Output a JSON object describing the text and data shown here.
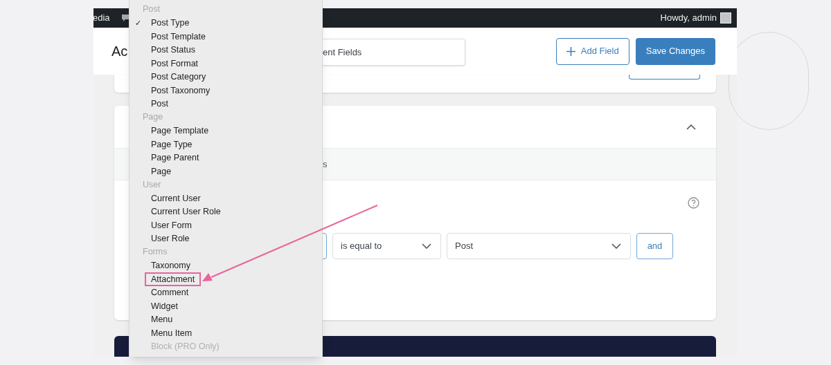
{
  "admin_bar": {
    "left_text": "edia",
    "greeting": "Howdy, admin"
  },
  "header": {
    "title": "Ac",
    "title_field_value": "ent Fields",
    "buttons": [
      {
        "label": "Add Field",
        "kind": "outline"
      },
      {
        "label": "Save Changes",
        "kind": "primary"
      }
    ]
  },
  "rules_card": {
    "band_text": "s",
    "condition": {
      "operator": "is equal to",
      "value": "Post",
      "and_button": "and"
    }
  },
  "dropdown": {
    "check_mark": "✓",
    "groups": [
      {
        "label": "Post",
        "items": [
          {
            "label": "Post Type",
            "checked": true,
            "disabled": false,
            "annotated": false
          },
          {
            "label": "Post Template",
            "checked": false,
            "disabled": false,
            "annotated": false
          },
          {
            "label": "Post Status",
            "checked": false,
            "disabled": false,
            "annotated": false
          },
          {
            "label": "Post Format",
            "checked": false,
            "disabled": false,
            "annotated": false
          },
          {
            "label": "Post Category",
            "checked": false,
            "disabled": false,
            "annotated": false
          },
          {
            "label": "Post Taxonomy",
            "checked": false,
            "disabled": false,
            "annotated": false
          },
          {
            "label": "Post",
            "checked": false,
            "disabled": false,
            "annotated": false
          }
        ]
      },
      {
        "label": "Page",
        "items": [
          {
            "label": "Page Template",
            "checked": false,
            "disabled": false,
            "annotated": false
          },
          {
            "label": "Page Type",
            "checked": false,
            "disabled": false,
            "annotated": false
          },
          {
            "label": "Page Parent",
            "checked": false,
            "disabled": false,
            "annotated": false
          },
          {
            "label": "Page",
            "checked": false,
            "disabled": false,
            "annotated": false
          }
        ]
      },
      {
        "label": "User",
        "items": [
          {
            "label": "Current User",
            "checked": false,
            "disabled": false,
            "annotated": false
          },
          {
            "label": "Current User Role",
            "checked": false,
            "disabled": false,
            "annotated": false
          },
          {
            "label": "User Form",
            "checked": false,
            "disabled": false,
            "annotated": false
          },
          {
            "label": "User Role",
            "checked": false,
            "disabled": false,
            "annotated": false
          }
        ]
      },
      {
        "label": "Forms",
        "items": [
          {
            "label": "Taxonomy",
            "checked": false,
            "disabled": false,
            "annotated": false
          },
          {
            "label": "Attachment",
            "checked": false,
            "disabled": false,
            "annotated": true
          },
          {
            "label": "Comment",
            "checked": false,
            "disabled": false,
            "annotated": false
          },
          {
            "label": "Widget",
            "checked": false,
            "disabled": false,
            "annotated": false
          },
          {
            "label": "Menu",
            "checked": false,
            "disabled": false,
            "annotated": false
          },
          {
            "label": "Menu Item",
            "checked": false,
            "disabled": false,
            "annotated": false
          },
          {
            "label": "Block (PRO Only)",
            "checked": false,
            "disabled": true,
            "annotated": false
          }
        ]
      }
    ]
  }
}
